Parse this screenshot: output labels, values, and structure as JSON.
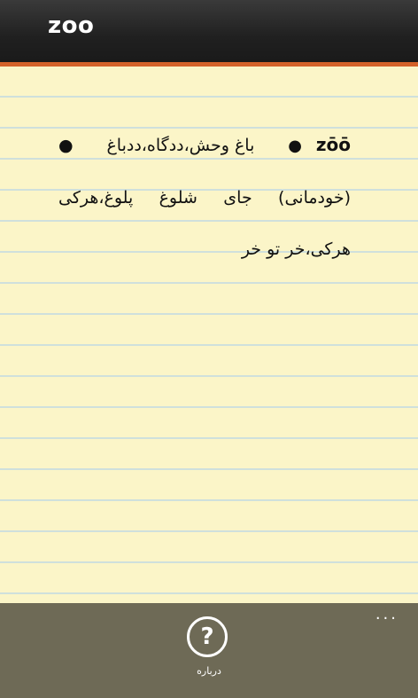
{
  "header": {
    "title": "zoo"
  },
  "entry": {
    "headword": "zōō",
    "bullet": "●",
    "definition": "باغ وحش،ددگاه،ددباغ ● (خودمانی) جای شلوغ پلوغ،هرکی هرکی،خر تو خر"
  },
  "appbar": {
    "more_label": "...",
    "help_icon": "question-circle-icon",
    "help_glyph": "?",
    "help_label": "درباره"
  },
  "colors": {
    "titlebar": "#202020",
    "accent": "#d4622a",
    "paper": "#fbf5c8",
    "rule_line": "#cfe0dc",
    "appbar": "#6e6a56"
  }
}
